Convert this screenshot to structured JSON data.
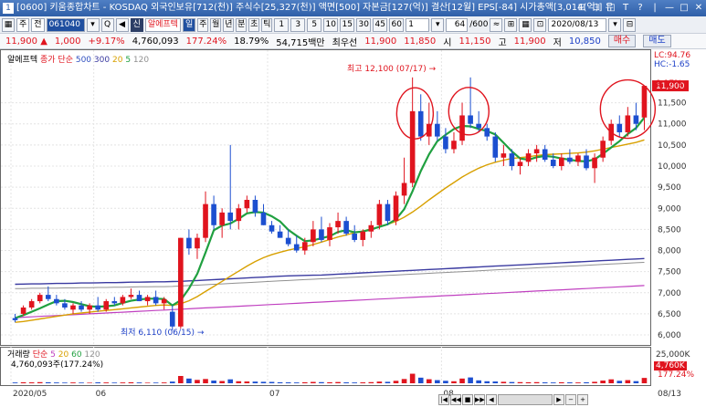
{
  "window": {
    "app_icon": "1",
    "title": "[0600] 키움종합차트 - KOSDAQ 외국인보유[712(천)] 주식수[25,327(천)] 액면[500] 자본금[127(억)] 결산[12월] EPS[-84] 시가총액[3,014(억)] 유",
    "controls": [
      "⊟",
      "⊡",
      "□",
      "T",
      "?",
      "|",
      "—",
      "□",
      "✕"
    ]
  },
  "toolbar": {
    "type_select": "주",
    "period_select": "전",
    "stock_code": "061040",
    "search_icon_glyph": "Q",
    "sound_glyph": "◀",
    "credit_badge": "신",
    "stock_name": "알에프텍",
    "day_badge": "일",
    "periods": [
      "주",
      "월",
      "년",
      "분",
      "초",
      "틱"
    ],
    "minutes": [
      "1",
      "3",
      "5",
      "10",
      "15",
      "30",
      "45",
      "60"
    ],
    "count_value": "1",
    "range_value": "64",
    "range_total": "/600",
    "tool_icons": [
      "≈",
      "⊞",
      "▦",
      "⊡"
    ],
    "date_value": "2020/08/13",
    "menu_icon": "⊟"
  },
  "pricebar": {
    "price": "11,900",
    "up_arrow": "▲",
    "change": "1,000",
    "change_rate": "+9.17%",
    "volume": "4,760,093",
    "volume_ratio": "177.24%",
    "turnover": "18.79%",
    "amount": "54,715백만",
    "best_label": "최우선",
    "best_ask": "11,900",
    "best_bid": "11,850",
    "open_label": "시",
    "open": "11,150",
    "high_label": "고",
    "high": "11,900",
    "low_label": "저",
    "low": "10,850",
    "buy_label": "매수",
    "sell_label": "매도"
  },
  "legend_price": {
    "name": "알에프텍",
    "type": "종가 단순",
    "ma": [
      "500",
      "300",
      "20",
      "5",
      "120"
    ],
    "ma_colors": [
      "#3050c0",
      "#3a3aa0",
      "#d8a000",
      "#20a040",
      "#909090"
    ]
  },
  "legend_volume": {
    "name": "거래량",
    "type": "단순",
    "ma": [
      "5",
      "20",
      "60",
      "120"
    ],
    "ma_colors": [
      "#c040c0",
      "#d8a000",
      "#20a040",
      "#909090"
    ],
    "value_text": "4,760,093주(177.24%)"
  },
  "annotations": {
    "high_text": "최고 12,100 (07/17)",
    "high_arrow": "→",
    "low_text": "최저 6,110 (06/15)",
    "low_arrow": "→",
    "lc": "LC:94.76",
    "hc": "HC:-1.65",
    "last_pct": "9.17%",
    "vol_last": "4,760K",
    "vol_pct": "177.24%"
  },
  "colors": {
    "up": "#e0141e",
    "down": "#1c4fd0",
    "ma5": "#20a040",
    "ma20": "#d8a000",
    "ma120": "#909090",
    "ma300": "#3a3aa0",
    "ma500": "#c040c0"
  },
  "chart_data": {
    "type": "candlestick",
    "y_ticks": [
      "11,500",
      "11,000",
      "10,500",
      "10,000",
      "9,500",
      "9,000",
      "8,500",
      "8,000",
      "7,500",
      "7,000",
      "6,500",
      "6,000"
    ],
    "y_range": [
      5850,
      12550
    ],
    "last_price_label": "11,900",
    "vol_ticks": [
      "25,000K"
    ],
    "vol_range": [
      0,
      26000
    ],
    "x_labels": [
      {
        "label": "2020/05",
        "index": 0
      },
      {
        "label": "06",
        "index": 10
      },
      {
        "label": "07",
        "index": 31
      },
      {
        "label": "08",
        "index": 52
      }
    ],
    "end_label": "08/13",
    "candles": [
      {
        "o": 6400,
        "h": 6500,
        "l": 6300,
        "c": 6350,
        "v": 700
      },
      {
        "o": 6500,
        "h": 6700,
        "l": 6450,
        "c": 6650,
        "v": 900
      },
      {
        "o": 6650,
        "h": 6850,
        "l": 6600,
        "c": 6800,
        "v": 800
      },
      {
        "o": 6800,
        "h": 7000,
        "l": 6750,
        "c": 6950,
        "v": 1000
      },
      {
        "o": 6950,
        "h": 7150,
        "l": 6800,
        "c": 6850,
        "v": 900
      },
      {
        "o": 6850,
        "h": 6950,
        "l": 6700,
        "c": 6750,
        "v": 700
      },
      {
        "o": 6750,
        "h": 6850,
        "l": 6600,
        "c": 6650,
        "v": 600
      },
      {
        "o": 6600,
        "h": 6750,
        "l": 6500,
        "c": 6700,
        "v": 700
      },
      {
        "o": 6700,
        "h": 6800,
        "l": 6550,
        "c": 6600,
        "v": 600
      },
      {
        "o": 6600,
        "h": 6750,
        "l": 6500,
        "c": 6700,
        "v": 500
      },
      {
        "o": 6700,
        "h": 6900,
        "l": 6550,
        "c": 6600,
        "v": 800
      },
      {
        "o": 6600,
        "h": 6850,
        "l": 6550,
        "c": 6800,
        "v": 700
      },
      {
        "o": 6800,
        "h": 6900,
        "l": 6700,
        "c": 6750,
        "v": 600
      },
      {
        "o": 6750,
        "h": 6950,
        "l": 6700,
        "c": 6900,
        "v": 700
      },
      {
        "o": 6900,
        "h": 7100,
        "l": 6850,
        "c": 6950,
        "v": 900
      },
      {
        "o": 6950,
        "h": 7050,
        "l": 6800,
        "c": 6800,
        "v": 700
      },
      {
        "o": 6800,
        "h": 6950,
        "l": 6700,
        "c": 6900,
        "v": 500
      },
      {
        "o": 6900,
        "h": 7050,
        "l": 6700,
        "c": 6750,
        "v": 600
      },
      {
        "o": 6750,
        "h": 6900,
        "l": 6600,
        "c": 6850,
        "v": 700
      },
      {
        "o": 6550,
        "h": 6700,
        "l": 6110,
        "c": 6200,
        "v": 1500
      },
      {
        "o": 6200,
        "h": 8300,
        "l": 6150,
        "c": 8300,
        "v": 6500
      },
      {
        "o": 8300,
        "h": 8500,
        "l": 7900,
        "c": 8050,
        "v": 4200
      },
      {
        "o": 8050,
        "h": 8400,
        "l": 7800,
        "c": 8300,
        "v": 3000
      },
      {
        "o": 8300,
        "h": 9400,
        "l": 8200,
        "c": 9100,
        "v": 3800
      },
      {
        "o": 9100,
        "h": 9300,
        "l": 8500,
        "c": 8600,
        "v": 2400
      },
      {
        "o": 8600,
        "h": 9000,
        "l": 8300,
        "c": 8900,
        "v": 2000
      },
      {
        "o": 8900,
        "h": 10500,
        "l": 8500,
        "c": 8700,
        "v": 3500
      },
      {
        "o": 8700,
        "h": 9100,
        "l": 8500,
        "c": 9000,
        "v": 1800
      },
      {
        "o": 9000,
        "h": 9300,
        "l": 8900,
        "c": 9200,
        "v": 1600
      },
      {
        "o": 9200,
        "h": 9300,
        "l": 8800,
        "c": 8900,
        "v": 1500
      },
      {
        "o": 8900,
        "h": 9100,
        "l": 8600,
        "c": 8600,
        "v": 1300
      },
      {
        "o": 8600,
        "h": 8700,
        "l": 8400,
        "c": 8450,
        "v": 1200
      },
      {
        "o": 8450,
        "h": 8600,
        "l": 8300,
        "c": 8300,
        "v": 900
      },
      {
        "o": 8300,
        "h": 8500,
        "l": 8100,
        "c": 8150,
        "v": 800
      },
      {
        "o": 8150,
        "h": 8350,
        "l": 7950,
        "c": 8000,
        "v": 700
      },
      {
        "o": 8000,
        "h": 8300,
        "l": 7900,
        "c": 8200,
        "v": 900
      },
      {
        "o": 8200,
        "h": 8700,
        "l": 8100,
        "c": 8500,
        "v": 1200
      },
      {
        "o": 8500,
        "h": 8800,
        "l": 8200,
        "c": 8250,
        "v": 1000
      },
      {
        "o": 8250,
        "h": 8650,
        "l": 8100,
        "c": 8550,
        "v": 900
      },
      {
        "o": 8550,
        "h": 8900,
        "l": 8400,
        "c": 8700,
        "v": 1100
      },
      {
        "o": 8700,
        "h": 8800,
        "l": 8350,
        "c": 8400,
        "v": 800
      },
      {
        "o": 8400,
        "h": 8600,
        "l": 8200,
        "c": 8250,
        "v": 700
      },
      {
        "o": 8250,
        "h": 8500,
        "l": 8100,
        "c": 8450,
        "v": 800
      },
      {
        "o": 8450,
        "h": 8700,
        "l": 8300,
        "c": 8600,
        "v": 1000
      },
      {
        "o": 8600,
        "h": 9200,
        "l": 8500,
        "c": 9100,
        "v": 1500
      },
      {
        "o": 9100,
        "h": 9200,
        "l": 8600,
        "c": 8700,
        "v": 1300
      },
      {
        "o": 8700,
        "h": 9400,
        "l": 8600,
        "c": 9300,
        "v": 2200
      },
      {
        "o": 9300,
        "h": 10200,
        "l": 9100,
        "c": 9600,
        "v": 3800
      },
      {
        "o": 9600,
        "h": 12100,
        "l": 9500,
        "c": 11300,
        "v": 8500
      },
      {
        "o": 11300,
        "h": 11700,
        "l": 10600,
        "c": 10700,
        "v": 5000
      },
      {
        "o": 10700,
        "h": 11500,
        "l": 10500,
        "c": 11000,
        "v": 3600
      },
      {
        "o": 11000,
        "h": 11300,
        "l": 10600,
        "c": 10700,
        "v": 2800
      },
      {
        "o": 10700,
        "h": 10900,
        "l": 10300,
        "c": 10400,
        "v": 2200
      },
      {
        "o": 10400,
        "h": 10800,
        "l": 10300,
        "c": 10600,
        "v": 1800
      },
      {
        "o": 10600,
        "h": 11500,
        "l": 10500,
        "c": 11200,
        "v": 4200
      },
      {
        "o": 11200,
        "h": 12100,
        "l": 10900,
        "c": 11000,
        "v": 5200
      },
      {
        "o": 11000,
        "h": 11300,
        "l": 10800,
        "c": 10900,
        "v": 2600
      },
      {
        "o": 10900,
        "h": 11000,
        "l": 10600,
        "c": 10700,
        "v": 1800
      },
      {
        "o": 10700,
        "h": 10800,
        "l": 10100,
        "c": 10200,
        "v": 1600
      },
      {
        "o": 10200,
        "h": 10500,
        "l": 10000,
        "c": 10300,
        "v": 1300
      },
      {
        "o": 10300,
        "h": 10400,
        "l": 9900,
        "c": 10000,
        "v": 1100
      },
      {
        "o": 10000,
        "h": 10200,
        "l": 9800,
        "c": 10100,
        "v": 1000
      },
      {
        "o": 10100,
        "h": 10400,
        "l": 10000,
        "c": 10300,
        "v": 900
      },
      {
        "o": 10300,
        "h": 10500,
        "l": 10100,
        "c": 10400,
        "v": 1000
      },
      {
        "o": 10400,
        "h": 10500,
        "l": 10100,
        "c": 10150,
        "v": 800
      },
      {
        "o": 10150,
        "h": 10300,
        "l": 9950,
        "c": 10000,
        "v": 700
      },
      {
        "o": 10000,
        "h": 10300,
        "l": 9900,
        "c": 10200,
        "v": 900
      },
      {
        "o": 10200,
        "h": 10400,
        "l": 10050,
        "c": 10100,
        "v": 800
      },
      {
        "o": 10100,
        "h": 10300,
        "l": 10000,
        "c": 10250,
        "v": 700
      },
      {
        "o": 10250,
        "h": 10400,
        "l": 9900,
        "c": 9950,
        "v": 900
      },
      {
        "o": 9950,
        "h": 10300,
        "l": 9600,
        "c": 10200,
        "v": 1300
      },
      {
        "o": 10200,
        "h": 10700,
        "l": 10100,
        "c": 10600,
        "v": 2400
      },
      {
        "o": 10600,
        "h": 11100,
        "l": 10500,
        "c": 11000,
        "v": 3500
      },
      {
        "o": 11000,
        "h": 11200,
        "l": 10700,
        "c": 10800,
        "v": 2200
      },
      {
        "o": 10800,
        "h": 11400,
        "l": 10700,
        "c": 11200,
        "v": 2800
      },
      {
        "o": 11200,
        "h": 11500,
        "l": 10850,
        "c": 11000,
        "v": 1900
      },
      {
        "o": 11150,
        "h": 11900,
        "l": 10850,
        "c": 11900,
        "v": 4760
      }
    ],
    "ma5": [
      6400,
      6470,
      6550,
      6630,
      6720,
      6800,
      6810,
      6780,
      6730,
      6680,
      6670,
      6680,
      6700,
      6760,
      6810,
      6840,
      6860,
      6860,
      6850,
      6700,
      6820,
      7100,
      7450,
      7950,
      8480,
      8590,
      8640,
      8750,
      8880,
      8910,
      8900,
      8810,
      8690,
      8490,
      8350,
      8220,
      8240,
      8290,
      8340,
      8440,
      8480,
      8430,
      8450,
      8500,
      8560,
      8620,
      8740,
      8980,
      9400,
      9880,
      10280,
      10590,
      10740,
      10880,
      10950,
      10940,
      10880,
      10830,
      10750,
      10550,
      10350,
      10180,
      10150,
      10210,
      10240,
      10220,
      10180,
      10150,
      10120,
      10110,
      10160,
      10290,
      10440,
      10590,
      10760,
      10900,
      11150
    ],
    "ma20": [
      6300,
      6320,
      6350,
      6380,
      6410,
      6440,
      6470,
      6500,
      6520,
      6540,
      6560,
      6580,
      6600,
      6620,
      6640,
      6660,
      6680,
      6700,
      6710,
      6700,
      6740,
      6810,
      6910,
      7030,
      7150,
      7270,
      7390,
      7510,
      7630,
      7740,
      7830,
      7900,
      7960,
      8010,
      8050,
      8090,
      8140,
      8200,
      8260,
      8320,
      8370,
      8420,
      8460,
      8510,
      8560,
      8620,
      8690,
      8790,
      8910,
      9050,
      9200,
      9340,
      9480,
      9610,
      9740,
      9850,
      9950,
      10030,
      10090,
      10140,
      10180,
      10200,
      10220,
      10250,
      10270,
      10280,
      10290,
      10300,
      10310,
      10330,
      10360,
      10400,
      10440,
      10480,
      10520,
      10560,
      10620
    ],
    "ma120": [
      7100,
      7100,
      7105,
      7105,
      7110,
      7110,
      7115,
      7115,
      7120,
      7120,
      7125,
      7125,
      7130,
      7130,
      7135,
      7140,
      7140,
      7145,
      7145,
      7150,
      7160,
      7170,
      7180,
      7190,
      7200,
      7210,
      7220,
      7230,
      7240,
      7250,
      7260,
      7270,
      7280,
      7290,
      7300,
      7310,
      7320,
      7330,
      7340,
      7350,
      7360,
      7370,
      7380,
      7390,
      7400,
      7410,
      7420,
      7430,
      7440,
      7450,
      7460,
      7470,
      7480,
      7490,
      7500,
      7510,
      7520,
      7530,
      7540,
      7550,
      7560,
      7570,
      7580,
      7590,
      7600,
      7610,
      7620,
      7630,
      7640,
      7650,
      7660,
      7670,
      7680,
      7690,
      7700,
      7710,
      7720
    ],
    "ma300": [
      7200,
      7205,
      7210,
      7210,
      7215,
      7220,
      7220,
      7225,
      7230,
      7230,
      7235,
      7240,
      7240,
      7245,
      7250,
      7250,
      7255,
      7260,
      7260,
      7265,
      7270,
      7280,
      7290,
      7300,
      7310,
      7320,
      7330,
      7340,
      7350,
      7360,
      7370,
      7380,
      7390,
      7400,
      7405,
      7410,
      7415,
      7420,
      7430,
      7440,
      7450,
      7460,
      7470,
      7480,
      7490,
      7500,
      7510,
      7520,
      7530,
      7540,
      7550,
      7560,
      7570,
      7580,
      7590,
      7600,
      7610,
      7620,
      7630,
      7640,
      7650,
      7660,
      7670,
      7680,
      7690,
      7700,
      7710,
      7720,
      7730,
      7740,
      7750,
      7760,
      7770,
      7780,
      7790,
      7800,
      7810
    ],
    "ma500": [
      6410,
      6420,
      6430,
      6440,
      6450,
      6460,
      6470,
      6480,
      6490,
      6500,
      6510,
      6520,
      6530,
      6540,
      6550,
      6560,
      6570,
      6580,
      6590,
      6600,
      6610,
      6620,
      6630,
      6640,
      6650,
      6660,
      6670,
      6680,
      6690,
      6700,
      6710,
      6720,
      6730,
      6740,
      6750,
      6760,
      6770,
      6780,
      6790,
      6800,
      6810,
      6820,
      6830,
      6840,
      6850,
      6860,
      6870,
      6880,
      6890,
      6900,
      6910,
      6920,
      6930,
      6940,
      6950,
      6960,
      6970,
      6980,
      6990,
      7000,
      7010,
      7020,
      7030,
      7040,
      7050,
      7060,
      7070,
      7080,
      7090,
      7100,
      7110,
      7120,
      7130,
      7140,
      7150,
      7160,
      7170
    ]
  }
}
